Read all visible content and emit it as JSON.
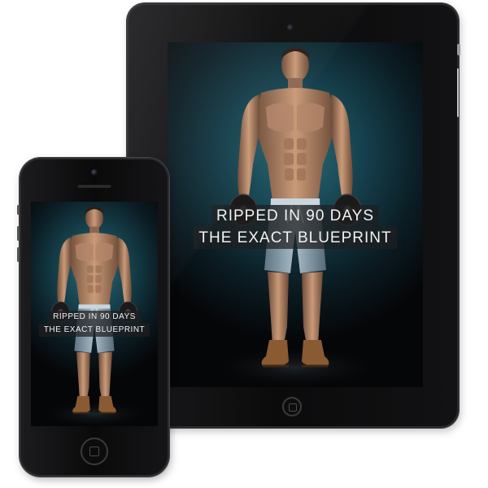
{
  "cover": {
    "title_line1": "RIPPED IN 90 DAYS",
    "title_line2": "THE EXACT BLUEPRINT"
  },
  "colors": {
    "screen_accent": "#2b6c78",
    "device_body": "#0d0d0e",
    "title_text": "#f2f2f2",
    "skin": "#b98a6a",
    "shorts": "#8fa6b4",
    "boots": "#8a5a32"
  },
  "icons": [
    "camera-icon",
    "speaker-grille-icon",
    "home-button-icon",
    "dumbbell-icon"
  ]
}
